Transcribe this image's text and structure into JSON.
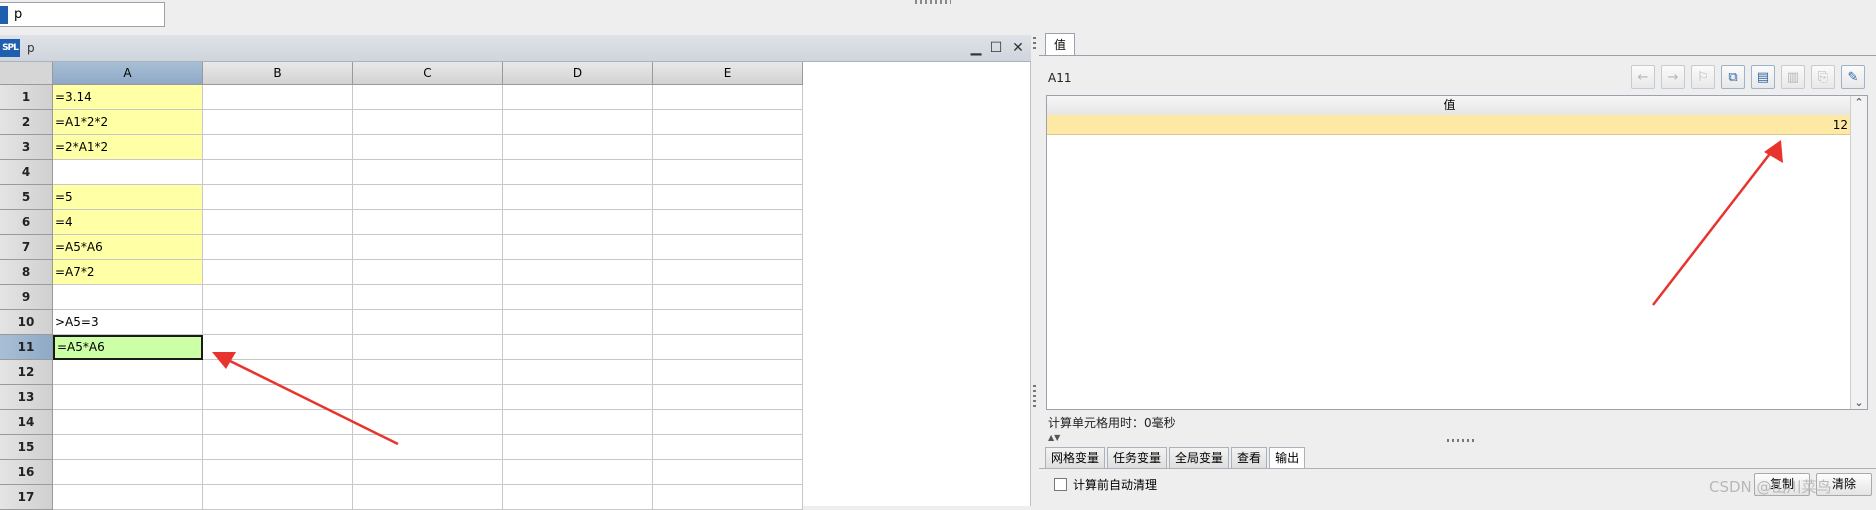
{
  "top": {
    "doc_tab_label": "p"
  },
  "grid": {
    "window_title": "p",
    "logo_text": "SPL",
    "columns": [
      "A",
      "B",
      "C",
      "D",
      "E"
    ],
    "rows": [
      {
        "num": "1",
        "a": "=3.14",
        "kind": "expr"
      },
      {
        "num": "2",
        "a": "=A1*2*2",
        "kind": "expr"
      },
      {
        "num": "3",
        "a": "=2*A1*2",
        "kind": "expr"
      },
      {
        "num": "4",
        "a": "",
        "kind": "plain"
      },
      {
        "num": "5",
        "a": "=5",
        "kind": "expr"
      },
      {
        "num": "6",
        "a": "=4",
        "kind": "expr"
      },
      {
        "num": "7",
        "a": "=A5*A6",
        "kind": "expr"
      },
      {
        "num": "8",
        "a": "=A7*2",
        "kind": "expr"
      },
      {
        "num": "9",
        "a": "",
        "kind": "plain"
      },
      {
        "num": "10",
        "a": ">A5=3",
        "kind": "plain"
      },
      {
        "num": "11",
        "a": "=A5*A6",
        "kind": "active"
      },
      {
        "num": "12",
        "a": "",
        "kind": "plain"
      },
      {
        "num": "13",
        "a": "",
        "kind": "plain"
      },
      {
        "num": "14",
        "a": "",
        "kind": "plain"
      },
      {
        "num": "15",
        "a": "",
        "kind": "plain"
      },
      {
        "num": "16",
        "a": "",
        "kind": "plain"
      },
      {
        "num": "17",
        "a": "",
        "kind": "plain"
      }
    ],
    "selected_row": "11",
    "selected_col": "A"
  },
  "value_panel": {
    "tab_label": "值",
    "cell_ref": "A11",
    "table_header": "值",
    "value": "12",
    "calc_time": "计算单元格用时：0毫秒",
    "bottom_tabs": [
      "网格变量",
      "任务变量",
      "全局变量",
      "查看",
      "输出"
    ],
    "active_bottom_tab": "输出",
    "auto_clear_label": "计算前自动清理",
    "copy_button": "复制",
    "clear_button": "清除",
    "watermark": "CSDN @山川菜鸟"
  },
  "toolbar_icons": [
    "back-icon",
    "forward-icon",
    "format-icon",
    "copy-value-icon",
    "table-view-icon",
    "chart-icon",
    "export-icon",
    "pin-icon"
  ],
  "colors": {
    "expr_cell": "#ffffa6",
    "active_cell": "#ccffa6",
    "value_row": "#fde9a4",
    "arrow": "#e8342e"
  }
}
